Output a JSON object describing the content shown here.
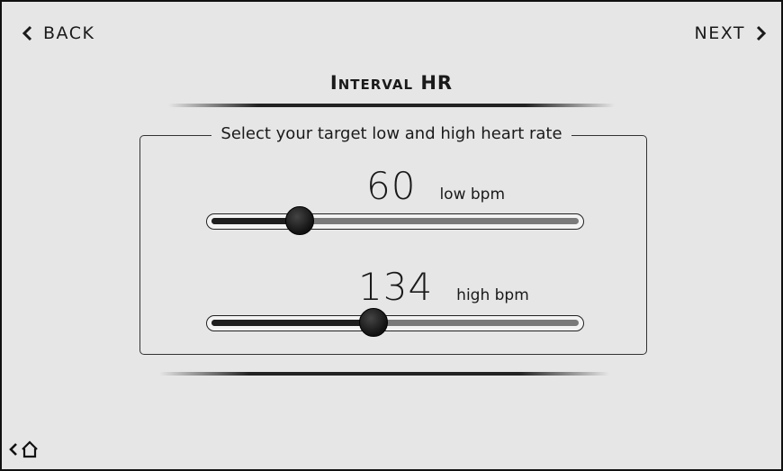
{
  "nav": {
    "back_label": "BACK",
    "next_label": "NEXT"
  },
  "header": {
    "title": "Interval HR"
  },
  "panel": {
    "legend": "Select your target low and high heart rate"
  },
  "low": {
    "value": "60",
    "unit": "low bpm",
    "slider_fraction": 0.24
  },
  "high": {
    "value": "134",
    "unit": "high bpm",
    "slider_fraction": 0.44
  },
  "footer": {
    "icons": [
      "chevron-left-icon",
      "home-icon"
    ]
  },
  "colors": {
    "background": "#e6e6e6",
    "fill": "#1e1e1e",
    "track": "#7a7a7a",
    "border": "#111111"
  }
}
